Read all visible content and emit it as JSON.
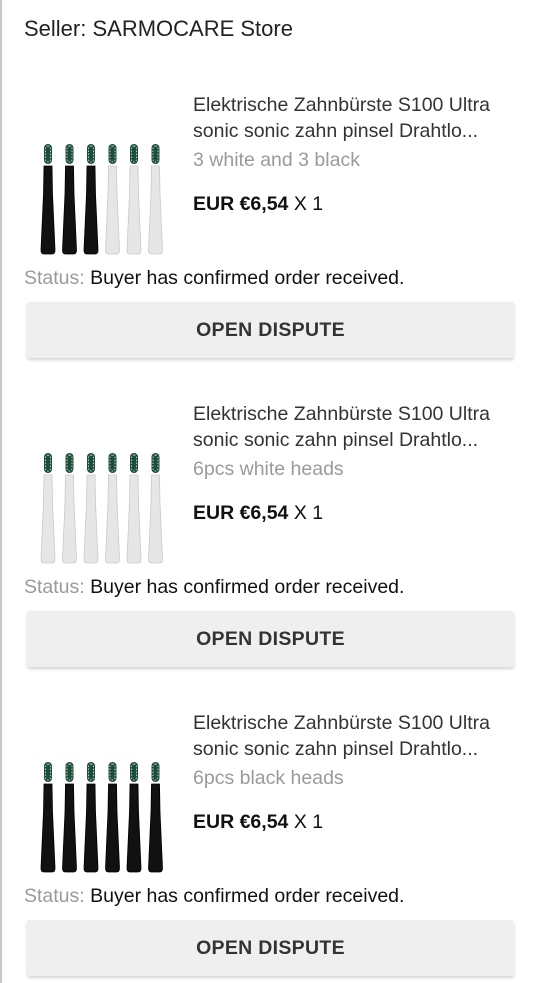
{
  "seller": {
    "label": "Seller: SARMOCARE Store"
  },
  "orders": [
    {
      "title": "Elektrische Zahnbürste S100 Ultra sonic sonic zahn pinsel Drahtlo...",
      "variant": "3 white and 3 black",
      "price": "EUR €6,54",
      "qty": "X 1",
      "status_label": "Status:",
      "status_text": "Buyer has confirmed order received.",
      "button": "OPEN DISPUTE",
      "heads": [
        "black",
        "black",
        "black",
        "white",
        "white",
        "white"
      ]
    },
    {
      "title": "Elektrische Zahnbürste S100 Ultra sonic sonic zahn pinsel Drahtlo...",
      "variant": "6pcs white heads",
      "price": "EUR €6,54",
      "qty": "X 1",
      "status_label": "Status:",
      "status_text": "Buyer has confirmed order received.",
      "button": "OPEN DISPUTE",
      "heads": [
        "white",
        "white",
        "white",
        "white",
        "white",
        "white"
      ]
    },
    {
      "title": "Elektrische Zahnbürste S100 Ultra sonic sonic zahn pinsel Drahtlo...",
      "variant": "6pcs black heads",
      "price": "EUR €6,54",
      "qty": "X 1",
      "status_label": "Status:",
      "status_text": "Buyer has confirmed order received.",
      "button": "OPEN DISPUTE",
      "heads": [
        "black",
        "black",
        "black",
        "black",
        "black",
        "black"
      ]
    }
  ],
  "colors": {
    "head_black": "#111111",
    "head_white": "#e6e6e6",
    "bristle": "#1f4d3a",
    "button_bg": "#efefef",
    "muted_text": "#9a9a9a"
  }
}
